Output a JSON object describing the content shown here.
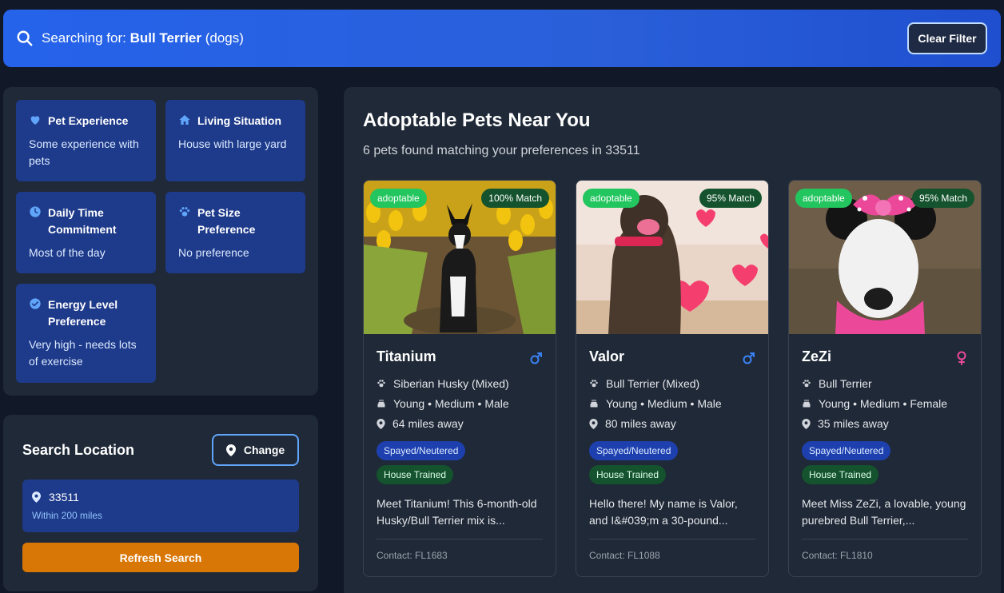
{
  "search": {
    "prefix": "Searching for: ",
    "breed": "Bull Terrier",
    "species": " (dogs)",
    "clear_label": "Clear Filter"
  },
  "preferences": [
    {
      "icon": "heart-icon",
      "title": "Pet Experience",
      "value": "Some experience with pets"
    },
    {
      "icon": "home-icon",
      "title": "Living Situation",
      "value": "House with large yard"
    },
    {
      "icon": "clock-icon",
      "title": "Daily Time Commitment",
      "value": "Most of the day"
    },
    {
      "icon": "paw-icon",
      "title": "Pet Size Preference",
      "value": "No preference"
    },
    {
      "icon": "check-circle-icon",
      "title": "Energy Level Preference",
      "value": "Very high - needs lots of exercise"
    }
  ],
  "location": {
    "title": "Search Location",
    "change_label": "Change",
    "zip": "33511",
    "radius": "Within 200 miles",
    "refresh_label": "Refresh Search"
  },
  "main": {
    "title": "Adoptable Pets Near You",
    "subtitle": "6 pets found matching your preferences in 33511"
  },
  "pets": [
    {
      "name": "Titanium",
      "gender": "male",
      "status": "adoptable",
      "match": "100% Match",
      "breed": "Siberian Husky (Mixed)",
      "traits": "Young • Medium • Male",
      "distance": "64 miles away",
      "tag1": "Spayed/Neutered",
      "tag2": "House Trained",
      "description": "Meet Titanium! This 6-month-old Husky/Bull Terrier mix is...",
      "contact": "Contact: FL1683"
    },
    {
      "name": "Valor",
      "gender": "male",
      "status": "adoptable",
      "match": "95% Match",
      "breed": "Bull Terrier (Mixed)",
      "traits": "Young • Medium • Male",
      "distance": "80 miles away",
      "tag1": "Spayed/Neutered",
      "tag2": "House Trained",
      "description": "Hello there! My name is Valor, and I&#039;m a 30-pound...",
      "contact": "Contact: FL1088"
    },
    {
      "name": "ZeZi",
      "gender": "female",
      "status": "adoptable",
      "match": "95% Match",
      "breed": "Bull Terrier",
      "traits": "Young • Medium • Female",
      "distance": "35 miles away",
      "tag1": "Spayed/Neutered",
      "tag2": "House Trained",
      "description": "Meet Miss ZeZi, a lovable, young purebred Bull Terrier,...",
      "contact": "Contact: FL1810"
    }
  ],
  "colors": {
    "accent": "#2563eb",
    "male": "#3b82f6",
    "female": "#ec4899",
    "adoptable": "#22c55e",
    "refresh": "#d97706"
  }
}
